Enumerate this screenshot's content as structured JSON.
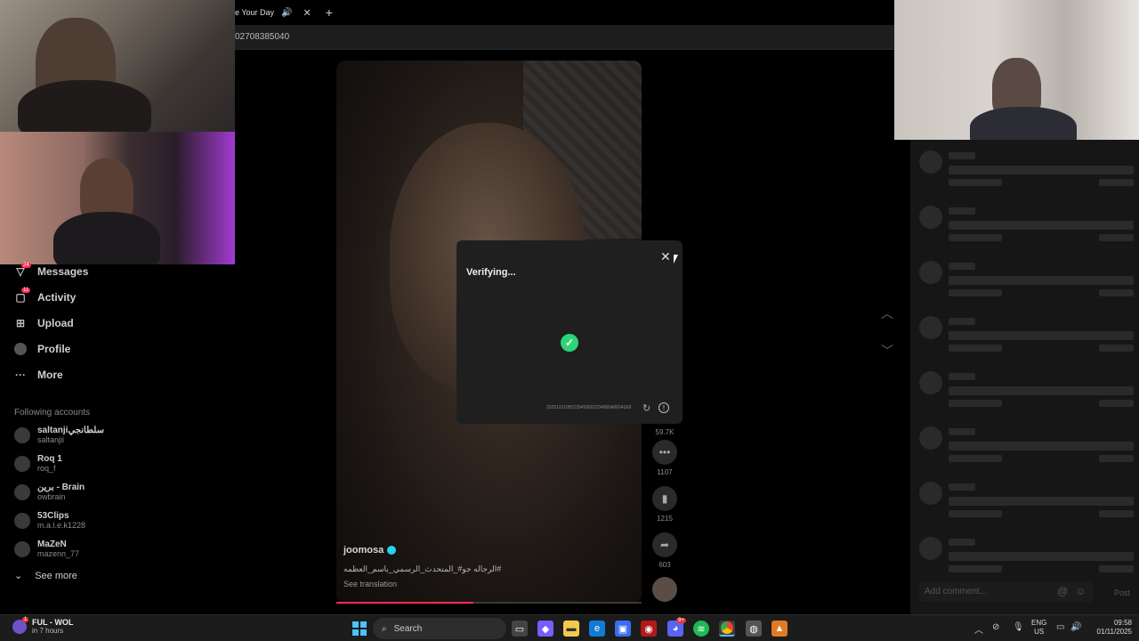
{
  "browser": {
    "tab_title": "e Your Day",
    "new_tab": "+",
    "address": "02708385040"
  },
  "sidebar": {
    "nav": [
      {
        "label": "Messages",
        "icon": "paper-plane-icon",
        "badge": "24"
      },
      {
        "label": "Activity",
        "icon": "inbox-icon",
        "badge": "11"
      },
      {
        "label": "Upload",
        "icon": "plus-square-icon"
      },
      {
        "label": "Profile",
        "icon": "avatar-icon"
      },
      {
        "label": "More",
        "icon": "ellipsis-icon"
      }
    ],
    "following_title": "Following accounts",
    "accounts": [
      {
        "name": "saltanjiسلطانجي",
        "handle": "saltanjii"
      },
      {
        "name": "Roq 1",
        "handle": "roq_f"
      },
      {
        "name": "برين - Brain",
        "handle": "owbrain"
      },
      {
        "name": "53Clips",
        "handle": "m.a.l.e.k1228"
      },
      {
        "name": "MaZeN",
        "handle": "mazenn_77"
      }
    ],
    "see_more": "See more"
  },
  "video": {
    "username": "joomosa",
    "caption": "#الرجاله جو#_المتحدث_الرسمي_باسم_العظمه",
    "translation": "See translation",
    "progress_fraction": 0.45
  },
  "actions": {
    "likes": "59.7K",
    "comments": "1107",
    "saves": "1215",
    "shares": "603"
  },
  "modal": {
    "title": "Verifying...",
    "close": "✕",
    "code": "20251101055233459602234866A86041E8"
  },
  "comments": {
    "placeholder": "Add comment...",
    "post": "Post"
  },
  "taskbar": {
    "weather_title": "FUL - WOL",
    "weather_sub": "in 7 hours",
    "weather_badge": "1",
    "search": "Search",
    "lang_1": "ENG",
    "lang_2": "US",
    "time": "09:58",
    "date": "01/11/2025",
    "discord_badge": "9+"
  },
  "colors": {
    "accent": "#fe2c55",
    "check": "#2ed47a",
    "verified": "#20d5ec"
  }
}
